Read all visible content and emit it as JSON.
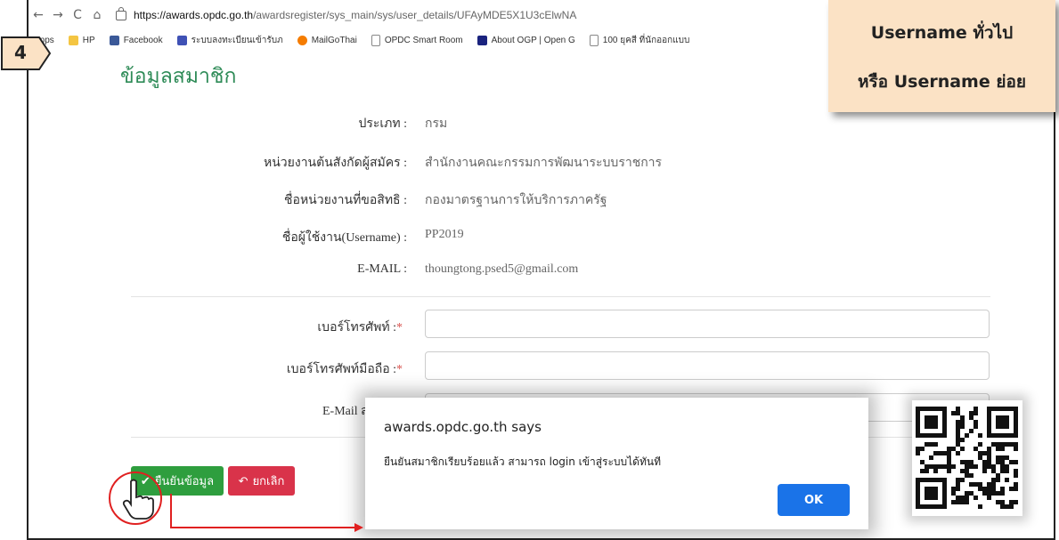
{
  "browser": {
    "url_host": "https://awards.opdc.go.th",
    "url_path": "/awardsregister/sys_main/sys/user_details/UFAyMDE5X1U3cElwNA",
    "bookmarks": [
      {
        "label": "Apps",
        "icon": "apps-icon"
      },
      {
        "label": "HP",
        "icon": "folder-icon"
      },
      {
        "label": "Facebook",
        "icon": "facebook-icon"
      },
      {
        "label": "ระบบลงทะเบียนเข้ารับภ",
        "icon": "list-icon"
      },
      {
        "label": "MailGoThai",
        "icon": "mail-icon"
      },
      {
        "label": "OPDC Smart Room",
        "icon": "page-icon"
      },
      {
        "label": "About OGP | Open G",
        "icon": "ogp-icon"
      },
      {
        "label": "100 ยุคสี ที่นักออกแบบ",
        "icon": "page-icon"
      }
    ]
  },
  "step_badge": "4",
  "page": {
    "title": "ข้อมูลสมาชิก",
    "fields": [
      {
        "label": "ประเภท :",
        "value": "กรม"
      },
      {
        "label": "หน่วยงานต้นสังกัดผู้สมัคร :",
        "value": "สำนักงานคณะกรรมการพัฒนาระบบราชการ"
      },
      {
        "label": "ชื่อหน่วยงานที่ขอสิทธิ :",
        "value": "กองมาตรฐานการให้บริการภาครัฐ"
      },
      {
        "label": "ชื่อผู้ใช้งาน(Username) :",
        "value": "PP2019"
      },
      {
        "label": "E-MAIL :",
        "value": "thoungtong.psed5@gmail.com"
      }
    ],
    "inputs": [
      {
        "label": "เบอร์โทรศัพท์ :",
        "required": "*",
        "value": ""
      },
      {
        "label": "เบอร์โทรศัพท์มือถือ :",
        "required": "*",
        "value": ""
      },
      {
        "label": "E-Mail ส",
        "required": "",
        "value": ""
      }
    ],
    "confirm_button": "ยืนยันข้อมูล",
    "cancel_button": "ยกเลิก"
  },
  "callout": {
    "line1": "Username ทั่วไป",
    "line2": "หรือ Username ย่อย",
    "bg": "#fbe2c5"
  },
  "dialog": {
    "title": "awards.opdc.go.th says",
    "message": "ยืนยันสมาชิกเรียบร้อยแล้ว สามารถ login เข้าสู่ระบบได้ทันที",
    "ok_label": "OK",
    "ok_color": "#1a73e8"
  },
  "colors": {
    "title": "#2e8b57",
    "confirm": "#2e9e3e",
    "cancel": "#d9334a",
    "annotation_red": "#e02020"
  }
}
